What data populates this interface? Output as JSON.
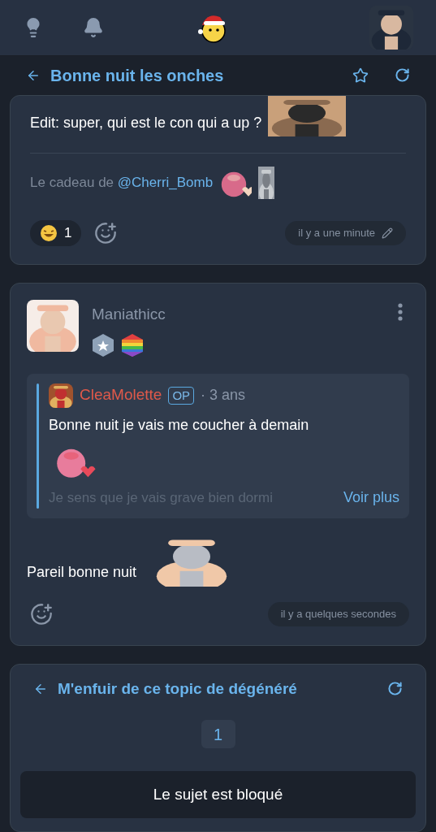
{
  "topic_header": {
    "title": "Bonne nuit les onches"
  },
  "posts": [
    {
      "kind": "continuation",
      "text": "Edit: super, qui est le con qui a up ?",
      "signature": {
        "prefix": "Le cadeau de",
        "mention": "@Cherri_Bomb"
      },
      "reactions": [
        {
          "count": "1"
        }
      ],
      "time": "il y a une minute",
      "edited": true
    },
    {
      "kind": "full",
      "author": "Maniathicc",
      "quote": {
        "author": "CleaMolette",
        "badge": "OP",
        "age": "· 3 ans",
        "text": "Bonne nuit je vais me coucher à demain",
        "more_text": "Je sens que je vais grave bien dormi",
        "more_link": "Voir plus"
      },
      "text": "Pareil bonne nuit",
      "time": "il y a quelques secondes",
      "edited": false
    }
  ],
  "footer": {
    "title": "M'enfuir de ce topic de dégénéré",
    "pages": [
      {
        "label": "1",
        "selected": true
      }
    ],
    "locked_message": "Le sujet est bloqué"
  }
}
